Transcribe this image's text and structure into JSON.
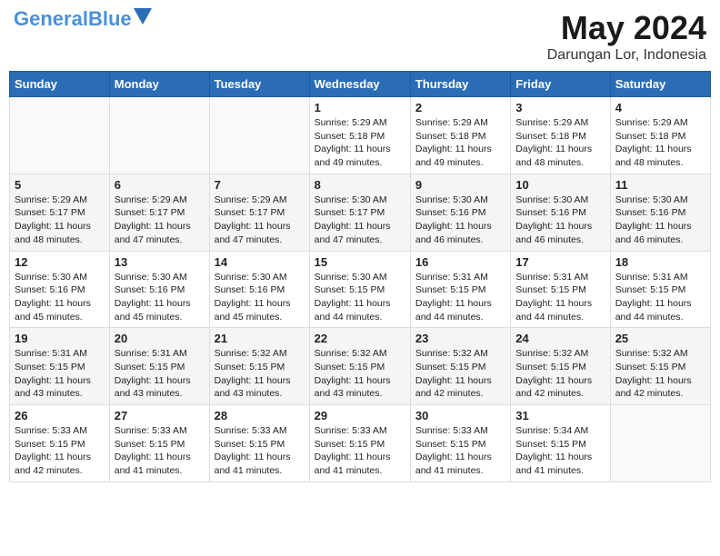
{
  "header": {
    "logo_line1": "General",
    "logo_line2": "Blue",
    "title": "May 2024",
    "subtitle": "Darungan Lor, Indonesia"
  },
  "days_of_week": [
    "Sunday",
    "Monday",
    "Tuesday",
    "Wednesday",
    "Thursday",
    "Friday",
    "Saturday"
  ],
  "weeks": [
    [
      {
        "day": "",
        "info": ""
      },
      {
        "day": "",
        "info": ""
      },
      {
        "day": "",
        "info": ""
      },
      {
        "day": "1",
        "info": "Sunrise: 5:29 AM\nSunset: 5:18 PM\nDaylight: 11 hours and 49 minutes."
      },
      {
        "day": "2",
        "info": "Sunrise: 5:29 AM\nSunset: 5:18 PM\nDaylight: 11 hours and 49 minutes."
      },
      {
        "day": "3",
        "info": "Sunrise: 5:29 AM\nSunset: 5:18 PM\nDaylight: 11 hours and 48 minutes."
      },
      {
        "day": "4",
        "info": "Sunrise: 5:29 AM\nSunset: 5:18 PM\nDaylight: 11 hours and 48 minutes."
      }
    ],
    [
      {
        "day": "5",
        "info": "Sunrise: 5:29 AM\nSunset: 5:17 PM\nDaylight: 11 hours and 48 minutes."
      },
      {
        "day": "6",
        "info": "Sunrise: 5:29 AM\nSunset: 5:17 PM\nDaylight: 11 hours and 47 minutes."
      },
      {
        "day": "7",
        "info": "Sunrise: 5:29 AM\nSunset: 5:17 PM\nDaylight: 11 hours and 47 minutes."
      },
      {
        "day": "8",
        "info": "Sunrise: 5:30 AM\nSunset: 5:17 PM\nDaylight: 11 hours and 47 minutes."
      },
      {
        "day": "9",
        "info": "Sunrise: 5:30 AM\nSunset: 5:16 PM\nDaylight: 11 hours and 46 minutes."
      },
      {
        "day": "10",
        "info": "Sunrise: 5:30 AM\nSunset: 5:16 PM\nDaylight: 11 hours and 46 minutes."
      },
      {
        "day": "11",
        "info": "Sunrise: 5:30 AM\nSunset: 5:16 PM\nDaylight: 11 hours and 46 minutes."
      }
    ],
    [
      {
        "day": "12",
        "info": "Sunrise: 5:30 AM\nSunset: 5:16 PM\nDaylight: 11 hours and 45 minutes."
      },
      {
        "day": "13",
        "info": "Sunrise: 5:30 AM\nSunset: 5:16 PM\nDaylight: 11 hours and 45 minutes."
      },
      {
        "day": "14",
        "info": "Sunrise: 5:30 AM\nSunset: 5:16 PM\nDaylight: 11 hours and 45 minutes."
      },
      {
        "day": "15",
        "info": "Sunrise: 5:30 AM\nSunset: 5:15 PM\nDaylight: 11 hours and 44 minutes."
      },
      {
        "day": "16",
        "info": "Sunrise: 5:31 AM\nSunset: 5:15 PM\nDaylight: 11 hours and 44 minutes."
      },
      {
        "day": "17",
        "info": "Sunrise: 5:31 AM\nSunset: 5:15 PM\nDaylight: 11 hours and 44 minutes."
      },
      {
        "day": "18",
        "info": "Sunrise: 5:31 AM\nSunset: 5:15 PM\nDaylight: 11 hours and 44 minutes."
      }
    ],
    [
      {
        "day": "19",
        "info": "Sunrise: 5:31 AM\nSunset: 5:15 PM\nDaylight: 11 hours and 43 minutes."
      },
      {
        "day": "20",
        "info": "Sunrise: 5:31 AM\nSunset: 5:15 PM\nDaylight: 11 hours and 43 minutes."
      },
      {
        "day": "21",
        "info": "Sunrise: 5:32 AM\nSunset: 5:15 PM\nDaylight: 11 hours and 43 minutes."
      },
      {
        "day": "22",
        "info": "Sunrise: 5:32 AM\nSunset: 5:15 PM\nDaylight: 11 hours and 43 minutes."
      },
      {
        "day": "23",
        "info": "Sunrise: 5:32 AM\nSunset: 5:15 PM\nDaylight: 11 hours and 42 minutes."
      },
      {
        "day": "24",
        "info": "Sunrise: 5:32 AM\nSunset: 5:15 PM\nDaylight: 11 hours and 42 minutes."
      },
      {
        "day": "25",
        "info": "Sunrise: 5:32 AM\nSunset: 5:15 PM\nDaylight: 11 hours and 42 minutes."
      }
    ],
    [
      {
        "day": "26",
        "info": "Sunrise: 5:33 AM\nSunset: 5:15 PM\nDaylight: 11 hours and 42 minutes."
      },
      {
        "day": "27",
        "info": "Sunrise: 5:33 AM\nSunset: 5:15 PM\nDaylight: 11 hours and 41 minutes."
      },
      {
        "day": "28",
        "info": "Sunrise: 5:33 AM\nSunset: 5:15 PM\nDaylight: 11 hours and 41 minutes."
      },
      {
        "day": "29",
        "info": "Sunrise: 5:33 AM\nSunset: 5:15 PM\nDaylight: 11 hours and 41 minutes."
      },
      {
        "day": "30",
        "info": "Sunrise: 5:33 AM\nSunset: 5:15 PM\nDaylight: 11 hours and 41 minutes."
      },
      {
        "day": "31",
        "info": "Sunrise: 5:34 AM\nSunset: 5:15 PM\nDaylight: 11 hours and 41 minutes."
      },
      {
        "day": "",
        "info": ""
      }
    ]
  ]
}
